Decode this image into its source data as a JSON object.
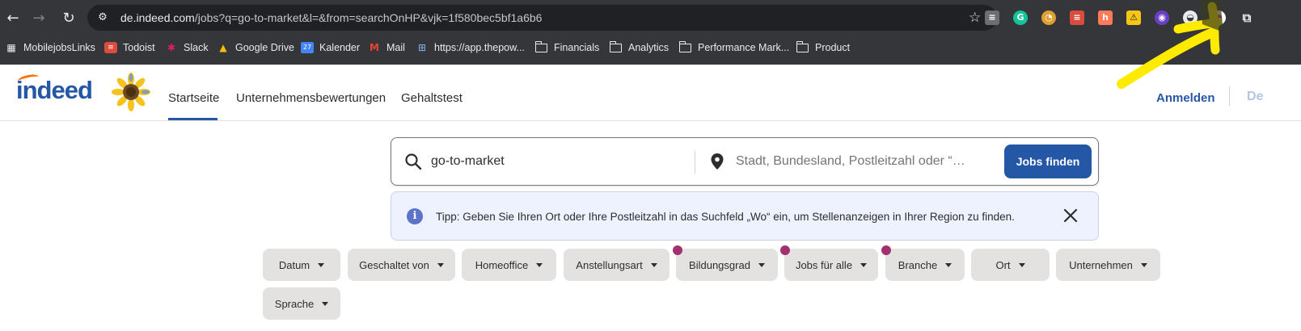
{
  "browser": {
    "url_host": "de.indeed.com",
    "url_rest": "/jobs?q=go-to-market&l=&from=searchOnHP&vjk=1f580bec5bf1a6b6",
    "extensions": [
      "stack-icon",
      "grammarly-icon",
      "chart-icon",
      "todoist-icon",
      "hubspot-icon",
      "warning-icon",
      "bot-icon",
      "ghost-icon",
      "pokeball-icon"
    ]
  },
  "bookmarks": [
    {
      "label": "MobilejobsLinks",
      "icon": "apps-icon"
    },
    {
      "label": "Todoist",
      "icon": "todoist-icon"
    },
    {
      "label": "Slack",
      "icon": "slack-icon"
    },
    {
      "label": "Google Drive",
      "icon": "drive-icon"
    },
    {
      "label": "Kalender",
      "icon": "calendar-icon"
    },
    {
      "label": "Mail",
      "icon": "gmail-icon"
    },
    {
      "label": "https://app.thepow...",
      "icon": "web-icon"
    },
    {
      "label": "Financials",
      "icon": "folder-icon"
    },
    {
      "label": "Analytics",
      "icon": "folder-icon"
    },
    {
      "label": "Performance Mark...",
      "icon": "folder-icon"
    },
    {
      "label": "Product",
      "icon": "folder-icon"
    }
  ],
  "calendar_badge": "27",
  "header": {
    "logo": "indeed",
    "nav": [
      "Startseite",
      "Unternehmensbewertungen",
      "Gehaltstest"
    ],
    "signin": "Anmelden",
    "employers_partial": "De"
  },
  "search": {
    "what_value": "go-to-market",
    "where_placeholder": "Stadt, Bundesland, Postleitzahl oder “…",
    "button": "Jobs finden"
  },
  "tip": {
    "text": "Tipp: Geben Sie Ihren Ort oder Ihre Postleitzahl in das Suchfeld „Wo“ ein, um Stellenanzeigen in Ihrer Region zu finden."
  },
  "filters": [
    "Datum",
    "Geschaltet von",
    "Homeoffice",
    "Anstellungsart",
    "Bildungsgrad",
    "Jobs für alle",
    "Branche",
    "Ort",
    "Unternehmen",
    "Sprache"
  ],
  "colors": {
    "brand": "#2557a7",
    "annotation": "#ffeb00",
    "dot": "#a1326f"
  }
}
